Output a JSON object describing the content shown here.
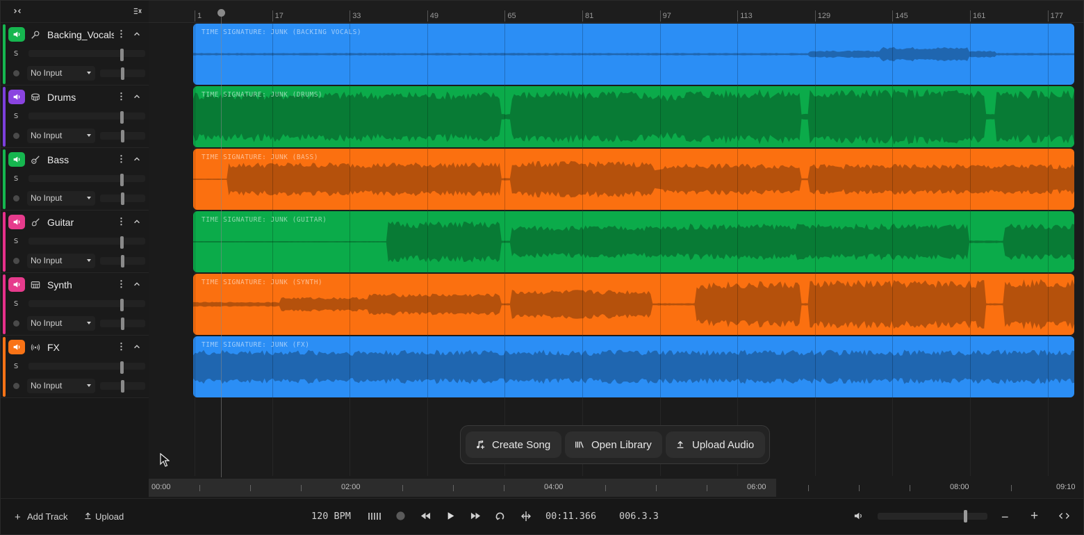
{
  "colors": {
    "blue": "#2b8ef5",
    "green": "#0bab4a",
    "orange": "#fb7010",
    "purple": "#7c3fdc",
    "pink": "#e6308a",
    "mute_green": "#16b64f",
    "mute_purple": "#8a44e0",
    "mute_pink": "#e63b8c",
    "mute_orange": "#f97316"
  },
  "toolbar": {
    "expand_icon": "expand-icon",
    "collapse_all_icon": "collapse-all-icon"
  },
  "ruler": {
    "labels": [
      "1",
      "17",
      "33",
      "49",
      "65",
      "81",
      "97",
      "113",
      "129",
      "145",
      "161",
      "177"
    ]
  },
  "tracks": [
    {
      "name": "Backing_Vocals",
      "icon": "microphone-icon",
      "input": "No Input",
      "solo": "S",
      "clip_label": "TIME SIGNATURE: JUNK (BACKING VOCALS)",
      "color": "#2b8ef5",
      "strip": "#16b64f",
      "mute": "#16b64f",
      "vol": 0.8
    },
    {
      "name": "Drums",
      "icon": "drum-icon",
      "input": "No Input",
      "solo": "S",
      "clip_label": "TIME SIGNATURE: JUNK (DRUMS)",
      "color": "#0bab4a",
      "strip": "#7c3fdc",
      "mute": "#8a44e0",
      "vol": 0.8
    },
    {
      "name": "Bass",
      "icon": "bass-guitar-icon",
      "input": "No Input",
      "solo": "S",
      "clip_label": "TIME SIGNATURE: JUNK (BASS)",
      "color": "#fb7010",
      "strip": "#16b64f",
      "mute": "#16b64f",
      "vol": 0.8
    },
    {
      "name": "Guitar",
      "icon": "guitar-icon",
      "input": "No Input",
      "solo": "S",
      "clip_label": "TIME SIGNATURE: JUNK (GUITAR)",
      "color": "#0bab4a",
      "strip": "#e6308a",
      "mute": "#e63b8c",
      "vol": 0.8
    },
    {
      "name": "Synth",
      "icon": "keyboard-icon",
      "input": "No Input",
      "solo": "S",
      "clip_label": "TIME SIGNATURE: JUNK (SYNTH)",
      "color": "#fb7010",
      "strip": "#e6308a",
      "mute": "#e63b8c",
      "vol": 0.8
    },
    {
      "name": "FX",
      "icon": "broadcast-icon",
      "input": "No Input",
      "solo": "S",
      "clip_label": "TIME SIGNATURE: JUNK (FX)",
      "color": "#2b8ef5",
      "strip": "#f97316",
      "mute": "#f97316",
      "vol": 0.8
    }
  ],
  "actions": {
    "create_song": "Create Song",
    "open_library": "Open Library",
    "upload_audio": "Upload Audio"
  },
  "timebar": {
    "labels": [
      "00:00",
      "02:00",
      "04:00",
      "06:00",
      "08:00",
      "09:10"
    ]
  },
  "bottom": {
    "add_track": "Add Track",
    "upload": "Upload",
    "bpm": "120 BPM",
    "time": "00:11.366",
    "position": "006.3.3",
    "zoom_level": 0.8
  }
}
